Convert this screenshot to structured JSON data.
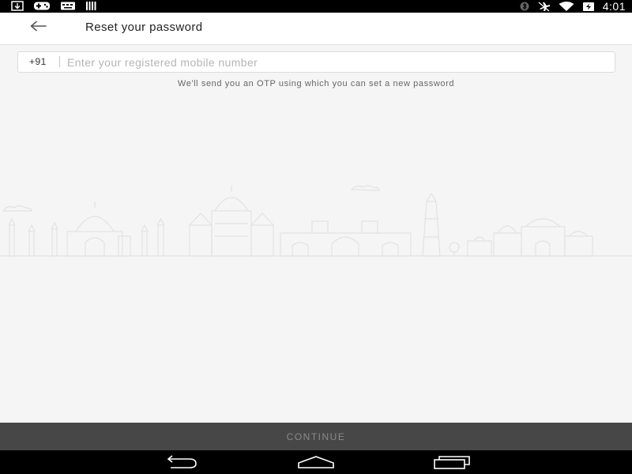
{
  "status_bar": {
    "left_icons": [
      "download-icon",
      "gamepad-icon",
      "keyboard-icon",
      "barcode-icon"
    ],
    "right_icons": [
      "bluetooth-icon",
      "airplane-mute-icon",
      "wifi-icon",
      "battery-charging-icon"
    ],
    "time": "4:01"
  },
  "app_bar": {
    "back_icon": "arrow-left-icon",
    "title": "Reset your password"
  },
  "phone": {
    "country_code": "+91",
    "placeholder": "Enter your registered mobile number",
    "value": ""
  },
  "helper_text": "We'll send you an OTP using which you can set a new password",
  "illustration": "city-skyline-illustration",
  "continue_label": "CONTINUE",
  "nav_bar": {
    "buttons": [
      "back-nav-icon",
      "home-nav-icon",
      "recents-nav-icon"
    ]
  }
}
